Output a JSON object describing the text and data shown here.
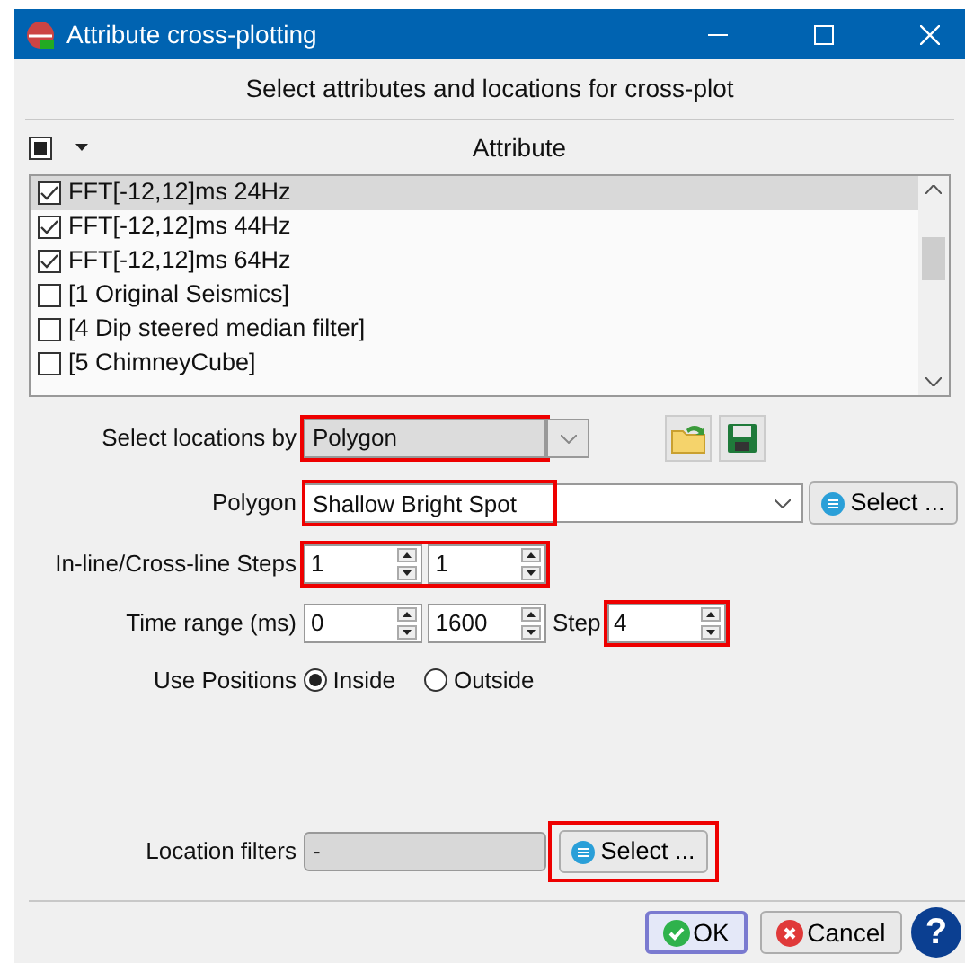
{
  "window": {
    "title": "Attribute cross-plotting"
  },
  "subtitle": "Select attributes and locations for cross-plot",
  "header": {
    "all_checked": true,
    "column": "Attribute"
  },
  "attributes": [
    {
      "label": "FFT[-12,12]ms 24Hz",
      "checked": true,
      "selected": true
    },
    {
      "label": "FFT[-12,12]ms 44Hz",
      "checked": true,
      "selected": false
    },
    {
      "label": "FFT[-12,12]ms 64Hz",
      "checked": true,
      "selected": false
    },
    {
      "label": "[1 Original Seismics]",
      "checked": false,
      "selected": false
    },
    {
      "label": "[4 Dip steered median filter]",
      "checked": false,
      "selected": false
    },
    {
      "label": "[5 ChimneyCube]",
      "checked": false,
      "selected": false
    }
  ],
  "locations_by": {
    "label": "Select locations by",
    "value": "Polygon",
    "highlighted": true
  },
  "polygon": {
    "label": "Polygon",
    "value": "Shallow Bright Spot",
    "highlighted": true,
    "button": "Select ..."
  },
  "steps": {
    "label": "In-line/Cross-line Steps",
    "inline": "1",
    "crossline": "1",
    "highlighted": true
  },
  "time_range": {
    "label": "Time range (ms)",
    "start": "0",
    "stop": "1600",
    "step_label": "Step",
    "step": "4",
    "step_highlighted": true
  },
  "positions": {
    "label": "Use Positions",
    "options": [
      {
        "label": "Inside",
        "selected": true
      },
      {
        "label": "Outside",
        "selected": false
      }
    ]
  },
  "location_filters": {
    "label": "Location filters",
    "value": "-",
    "button": "Select ...",
    "highlighted": true
  },
  "buttons": [
    {
      "kind": "ok",
      "label": "OK",
      "default": true
    },
    {
      "kind": "cancel",
      "label": "Cancel",
      "default": false
    },
    {
      "kind": "help",
      "label": "?"
    }
  ]
}
